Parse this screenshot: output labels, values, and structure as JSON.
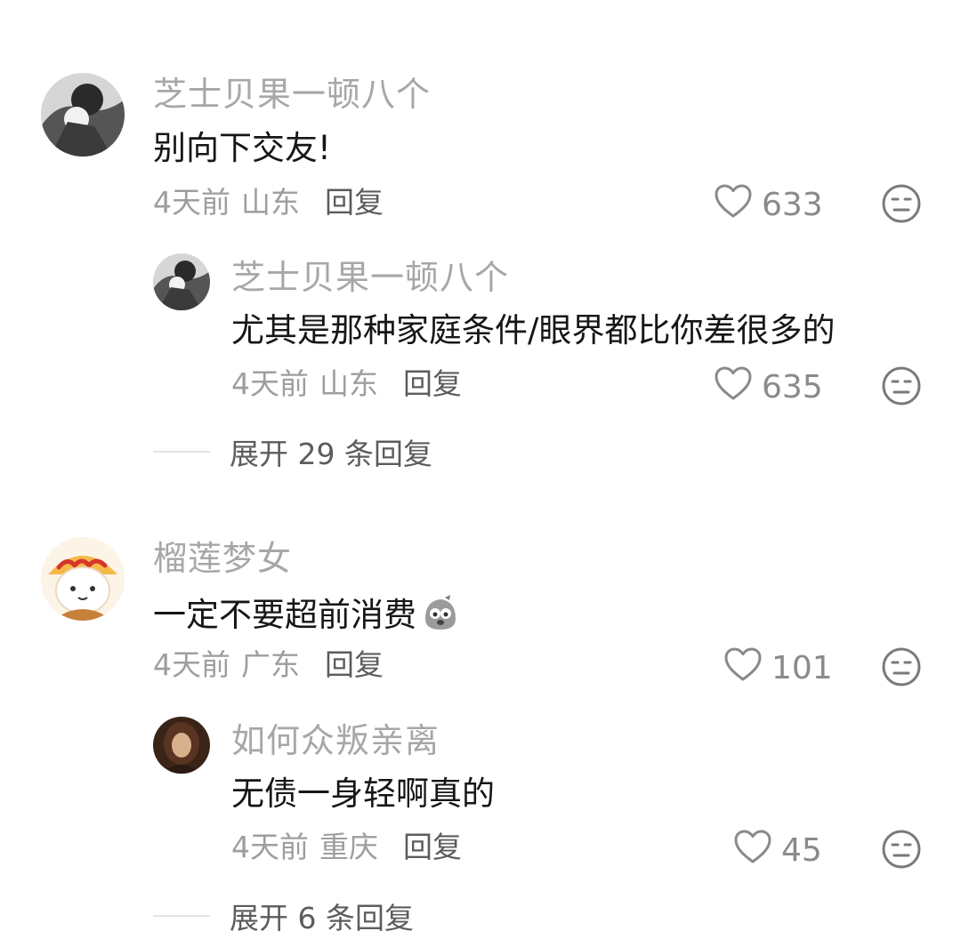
{
  "threads": [
    {
      "comment": {
        "user": "芝士贝果一顿八个",
        "text": "别向下交友!",
        "time": "4天前",
        "location": "山东",
        "reply_label": "回复",
        "likes": "633"
      },
      "reply": {
        "user": "芝士贝果一顿八个",
        "text": "尤其是那种家庭条件/眼界都比你差很多的",
        "time": "4天前",
        "location": "山东",
        "reply_label": "回复",
        "likes": "635"
      },
      "expand_label": "展开 29 条回复"
    },
    {
      "comment": {
        "user": "榴莲梦女",
        "text": "一定不要超前消费",
        "time": "4天前",
        "location": "广东",
        "reply_label": "回复",
        "likes": "101"
      },
      "reply": {
        "user": "如何众叛亲离",
        "text": "无债一身轻啊真的",
        "time": "4天前",
        "location": "重庆",
        "reply_label": "回复",
        "likes": "45"
      },
      "expand_label": "展开 6 条回复"
    }
  ],
  "icons": {
    "like": "heart-outline-icon",
    "dislike": "meh-face-icon",
    "emoji": "worried-face-emoji"
  },
  "colors": {
    "username": "#a7a7a7",
    "text": "#161616",
    "meta": "#9e9e9e",
    "reply": "#5c5c5c"
  }
}
